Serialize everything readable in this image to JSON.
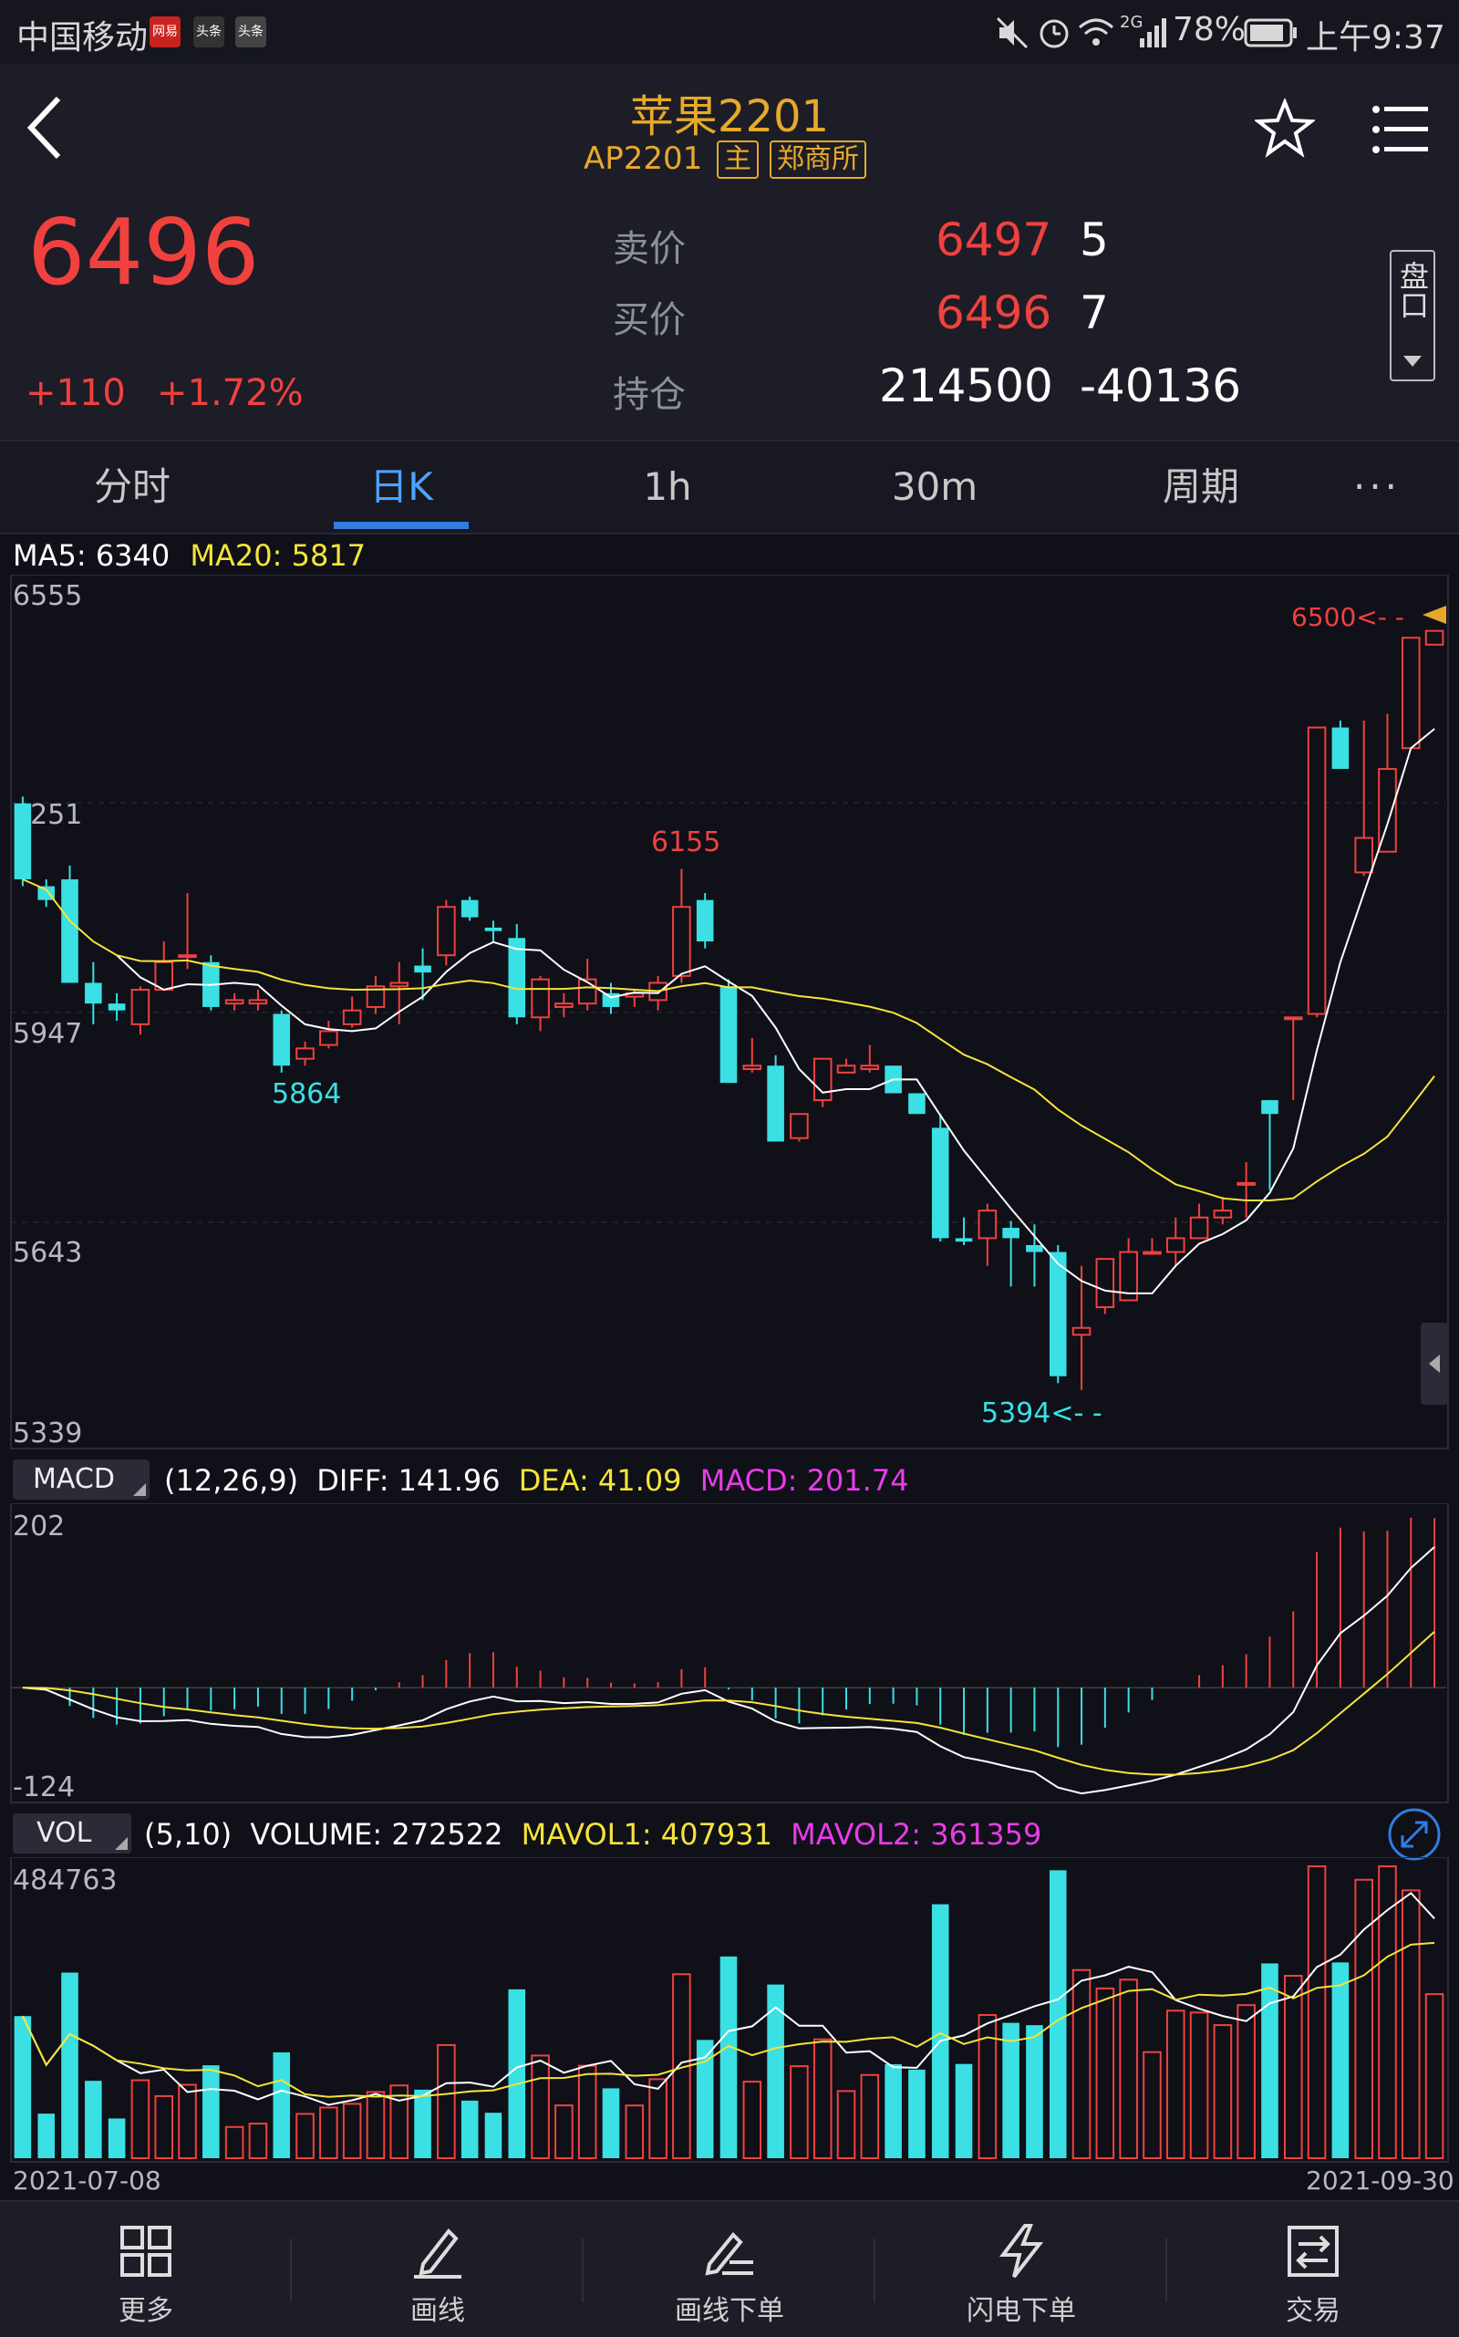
{
  "statusbar": {
    "carrier": "中国移动",
    "badges": [
      "网易",
      "头条",
      "头条"
    ],
    "network": "2G",
    "battery": "78%",
    "time": "上午9:37"
  },
  "header": {
    "title": "苹果2201",
    "code": "AP2201",
    "tag_main": "主",
    "tag_exchange": "郑商所",
    "price": "6496",
    "change": "+110",
    "change_pct": "+1.72%",
    "ask_label": "卖价",
    "ask_price": "6497",
    "ask_vol": "5",
    "bid_label": "买价",
    "bid_price": "6496",
    "bid_vol": "7",
    "oi_label": "持仓",
    "oi_value": "214500",
    "oi_change": "-40136",
    "panel_button": "盘口"
  },
  "tabs": [
    {
      "label": "分时"
    },
    {
      "label": "日K"
    },
    {
      "label": "1h"
    },
    {
      "label": "30m"
    },
    {
      "label": "周期"
    },
    {
      "label": "···"
    }
  ],
  "main_chart": {
    "ma5_label": "MA5: 6340",
    "ma20_label": "MA20: 5817",
    "axis": [
      "6555",
      "6251",
      "5947",
      "5643",
      "5339"
    ],
    "high_label": "6155",
    "low_label_1": "5864",
    "low_label_2": "5394<- -",
    "last_label": "6500<- -"
  },
  "macd": {
    "button": "MACD",
    "params": "(12,26,9)",
    "diff": "DIFF: 141.96",
    "dea": "DEA: 41.09",
    "macd": "MACD: 201.74",
    "axis_top": "202",
    "axis_bottom": "-124"
  },
  "vol": {
    "button": "VOL",
    "params": "(5,10)",
    "volume": "VOLUME: 272522",
    "mavol1": "MAVOL1: 407931",
    "mavol2": "MAVOL2: 361359",
    "axis_top": "484763",
    "date_start": "2021-07-08",
    "date_end": "2021-09-30"
  },
  "bottom_nav": [
    {
      "label": "更多",
      "icon": "grid-icon"
    },
    {
      "label": "画线",
      "icon": "pen-icon"
    },
    {
      "label": "画线下单",
      "icon": "sign-pen-icon"
    },
    {
      "label": "闪电下单",
      "icon": "lightning-icon"
    },
    {
      "label": "交易",
      "icon": "trade-arrows-icon"
    }
  ],
  "colors": {
    "up": "#f0413f",
    "down": "#3ae0e4",
    "ma5": "#ffffff",
    "ma20": "#f5e43a",
    "accent": "#2f7de0",
    "gold": "#e8a92a"
  },
  "chart_data": {
    "type": "candlestick",
    "price_range": [
      5339,
      6555
    ],
    "ma5_last": 6340,
    "ma20_last": 5817,
    "candles": [
      [
        6250,
        6260,
        6130,
        6140
      ],
      [
        6130,
        6140,
        6100,
        6110
      ],
      [
        6140,
        6160,
        5990,
        5990
      ],
      [
        5990,
        6020,
        5930,
        5960
      ],
      [
        5960,
        5975,
        5935,
        5950
      ],
      [
        5930,
        5985,
        5915,
        5980
      ],
      [
        5980,
        6050,
        6000,
        6020
      ],
      [
        6030,
        6120,
        6010,
        6030
      ],
      [
        6020,
        6030,
        5950,
        5955
      ],
      [
        5960,
        5975,
        5950,
        5965
      ],
      [
        5960,
        5980,
        5950,
        5965
      ],
      [
        5945,
        5950,
        5860,
        5870
      ],
      [
        5880,
        5905,
        5870,
        5895
      ],
      [
        5900,
        5935,
        5895,
        5920
      ],
      [
        5930,
        5970,
        5925,
        5950
      ],
      [
        5955,
        6000,
        5945,
        5985
      ],
      [
        5985,
        6020,
        5930,
        5990
      ],
      [
        6015,
        6040,
        5965,
        6005
      ],
      [
        6030,
        6110,
        6015,
        6100
      ],
      [
        6110,
        6115,
        6080,
        6085
      ],
      [
        6070,
        6080,
        6050,
        6065
      ],
      [
        6055,
        6075,
        5930,
        5940
      ],
      [
        5940,
        6000,
        5920,
        5995
      ],
      [
        5955,
        5975,
        5940,
        5960
      ],
      [
        5960,
        6025,
        5950,
        5995
      ],
      [
        5975,
        5990,
        5945,
        5955
      ],
      [
        5970,
        5980,
        5955,
        5975
      ],
      [
        5965,
        6000,
        5950,
        5990
      ],
      [
        6000,
        6155,
        5990,
        6100
      ],
      [
        6110,
        6120,
        6040,
        6050
      ],
      [
        5985,
        5995,
        5845,
        5845
      ],
      [
        5865,
        5910,
        5860,
        5870
      ],
      [
        5870,
        5885,
        5765,
        5760
      ],
      [
        5765,
        5800,
        5760,
        5800
      ],
      [
        5820,
        5870,
        5810,
        5880
      ],
      [
        5860,
        5880,
        5870,
        5870
      ],
      [
        5865,
        5900,
        5860,
        5870
      ],
      [
        5870,
        5850,
        5830,
        5830
      ],
      [
        5830,
        5815,
        5800,
        5800
      ],
      [
        5780,
        5800,
        5615,
        5620
      ],
      [
        5620,
        5650,
        5610,
        5615
      ],
      [
        5620,
        5670,
        5580,
        5660
      ],
      [
        5635,
        5645,
        5550,
        5620
      ],
      [
        5610,
        5640,
        5550,
        5600
      ],
      [
        5600,
        5610,
        5410,
        5420
      ],
      [
        5480,
        5580,
        5400,
        5490
      ],
      [
        5520,
        5590,
        5510,
        5590
      ],
      [
        5530,
        5620,
        5530,
        5600
      ],
      [
        5600,
        5620,
        5600,
        5600
      ],
      [
        5600,
        5650,
        5580,
        5620
      ],
      [
        5620,
        5670,
        5620,
        5650
      ],
      [
        5650,
        5680,
        5640,
        5660
      ],
      [
        5700,
        5730,
        5650,
        5700
      ],
      [
        5820,
        5820,
        5690,
        5800
      ],
      [
        5940,
        5940,
        5820,
        5940
      ],
      [
        5945,
        6360,
        5940,
        6360
      ],
      [
        6360,
        6370,
        6300,
        6300
      ],
      [
        6150,
        6370,
        6145,
        6200
      ],
      [
        6180,
        6380,
        6180,
        6300
      ],
      [
        6330,
        6470,
        6390,
        6490
      ],
      [
        6480,
        6500,
        6480,
        6500
      ]
    ],
    "macd": {
      "diff_last": 141.96,
      "dea_last": 41.09,
      "macd_last": 201.74,
      "range": [
        -124,
        202
      ]
    },
    "volume": {
      "volume_last": 272522,
      "mavol1_last": 407931,
      "mavol2_last": 361359,
      "max": 484763,
      "x_start": "2021-07-08",
      "x_end": "2021-09-30"
    }
  }
}
